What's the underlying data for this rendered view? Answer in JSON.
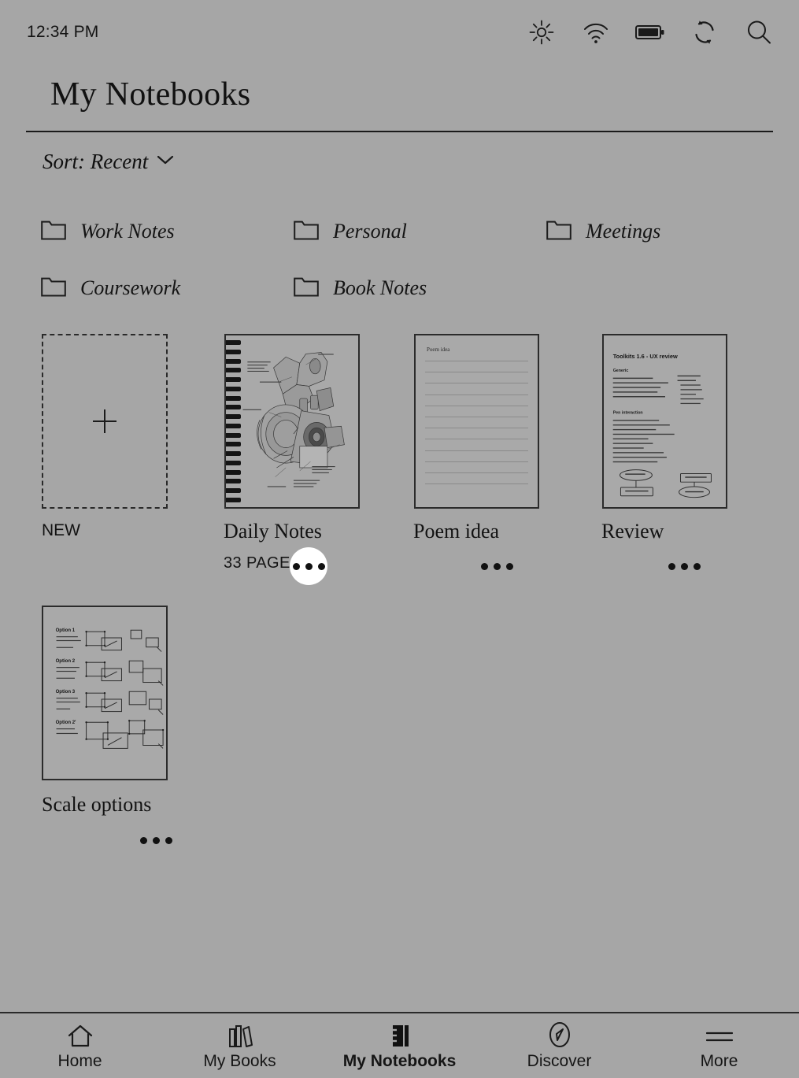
{
  "status_bar": {
    "time": "12:34 PM",
    "icons": [
      {
        "name": "brightness-icon",
        "label": "Brightness"
      },
      {
        "name": "wifi-icon",
        "label": "Wi-Fi"
      },
      {
        "name": "battery-icon",
        "label": "Battery"
      },
      {
        "name": "sync-icon",
        "label": "Sync"
      },
      {
        "name": "search-icon",
        "label": "Search"
      }
    ]
  },
  "header": {
    "title": "My Notebooks"
  },
  "sort": {
    "label": "Sort: Recent",
    "icon": "chevron-down-icon"
  },
  "folders": [
    {
      "name": "Work Notes"
    },
    {
      "name": "Personal"
    },
    {
      "name": "Meetings"
    },
    {
      "name": "Coursework"
    },
    {
      "name": "Book Notes"
    }
  ],
  "new_tile": {
    "label": "NEW",
    "icon": "plus-icon"
  },
  "notebooks": [
    {
      "title": "Daily Notes",
      "pages": "33 PAGES",
      "thumbnail_type": "spiral-sketch",
      "menu_active": true,
      "menu_label": "•••"
    },
    {
      "title": "Poem idea",
      "pages": "",
      "thumbnail_type": "lined-page",
      "thumbnail_title": "Poem idea",
      "menu_active": false,
      "menu_label": "•••"
    },
    {
      "title": "Review",
      "pages": "",
      "thumbnail_type": "document",
      "thumbnail_title": "Toolkits 1.6 - UX review",
      "thumbnail_sections": [
        "Generic",
        "Pen interaction"
      ],
      "menu_active": false,
      "menu_label": "•••"
    },
    {
      "title": "Scale options",
      "pages": "",
      "thumbnail_type": "options-diagram",
      "thumbnail_options": [
        "Option 1",
        "Option 2",
        "Option 3",
        "Option 2'"
      ],
      "menu_active": false,
      "menu_label": "•••"
    }
  ],
  "bottom_nav": [
    {
      "label": "Home",
      "icon": "home-icon",
      "active": false
    },
    {
      "label": "My Books",
      "icon": "books-icon",
      "active": false
    },
    {
      "label": "My Notebooks",
      "icon": "notebook-icon",
      "active": true
    },
    {
      "label": "Discover",
      "icon": "compass-icon",
      "active": false
    },
    {
      "label": "More",
      "icon": "menu-icon",
      "active": false
    }
  ],
  "colors": {
    "background": "#a6a6a6",
    "foreground": "#111111",
    "highlight": "#ffffff"
  }
}
